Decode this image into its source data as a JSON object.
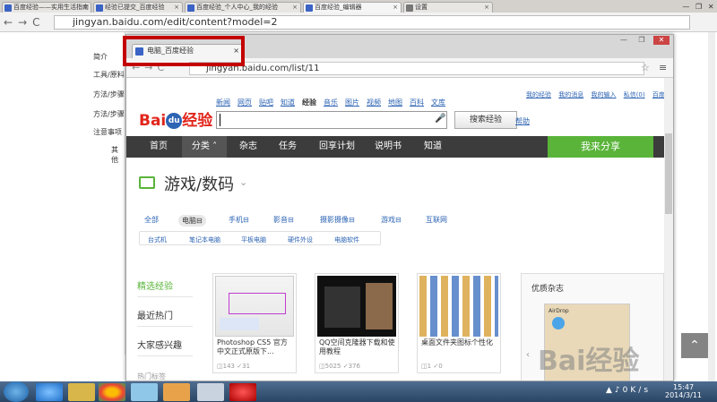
{
  "outer_tabs": [
    "百度经验——实用生活指南",
    "经验已提交_百度经验",
    "百度经验_个人中心_我的经验",
    "百度经验_编辑器",
    "设置"
  ],
  "outer_url": "jingyan.baidu.com/edit/content?model=2",
  "underlying_sidebar": [
    "简介",
    "工具/原料",
    "方法/步骤",
    "方法/步骤",
    "注意事项",
    "其他"
  ],
  "inner_tab": "电脑_百度经验",
  "inner_url": "jingyan.baidu.com/list/11",
  "topbar_links": [
    "我的经验",
    "我的消息",
    "我的输入",
    "私信(0)",
    "百度首页"
  ],
  "nav_links": [
    "新闻",
    "网页",
    "贴吧",
    "知道",
    "经验",
    "音乐",
    "图片",
    "视频",
    "地图",
    "百科",
    "文库"
  ],
  "nav_current": "经验",
  "logo": {
    "bai": "Bai",
    "du": "du",
    "jingyan": "经验"
  },
  "search": {
    "button": "搜索经验",
    "help": "帮助",
    "mic": "🎤"
  },
  "main_nav": [
    "首页",
    "分类",
    "杂志",
    "任务",
    "回享计划",
    "说明书",
    "知道"
  ],
  "main_nav_active": "分类",
  "share": "我来分享",
  "category": {
    "title": "游戏/数码",
    "caret": "⌄"
  },
  "subcats": [
    "全部",
    "电脑⊟",
    "手机⊟",
    "影音⊟",
    "摄影摄像⊟",
    "游戏⊟",
    "互联网"
  ],
  "subcats2": [
    "台式机",
    "笔记本电脑",
    "平板电脑",
    "硬件外设",
    "电脑软件"
  ],
  "side_tabs": [
    "精选经验",
    "最近热门",
    "大家感兴趣",
    "热门标签"
  ],
  "cards": [
    {
      "title": "Photoshop CS5 官方中文正式原版下...",
      "views": "143",
      "votes": "31"
    },
    {
      "title": "QQ空间克隆器下载和使用教程",
      "views": "5025",
      "votes": "376"
    },
    {
      "title": "桌面文件夹图标个性化",
      "views": "1",
      "votes": "0"
    }
  ],
  "magazine": {
    "title": "优质杂志",
    "item": "AirDrop"
  },
  "watermark": "Bai经验",
  "back_top": "⌃",
  "tray": {
    "time": "15:47",
    "date": "2014/3/11",
    "speed": "0K/s"
  },
  "win_ctrl": [
    "—",
    "❐",
    "✕"
  ],
  "colors": {
    "accent_green": "#5ab43a",
    "brand_red": "#e1251b",
    "brand_blue": "#2d64b3",
    "nav_dark": "#3c3c3c"
  }
}
